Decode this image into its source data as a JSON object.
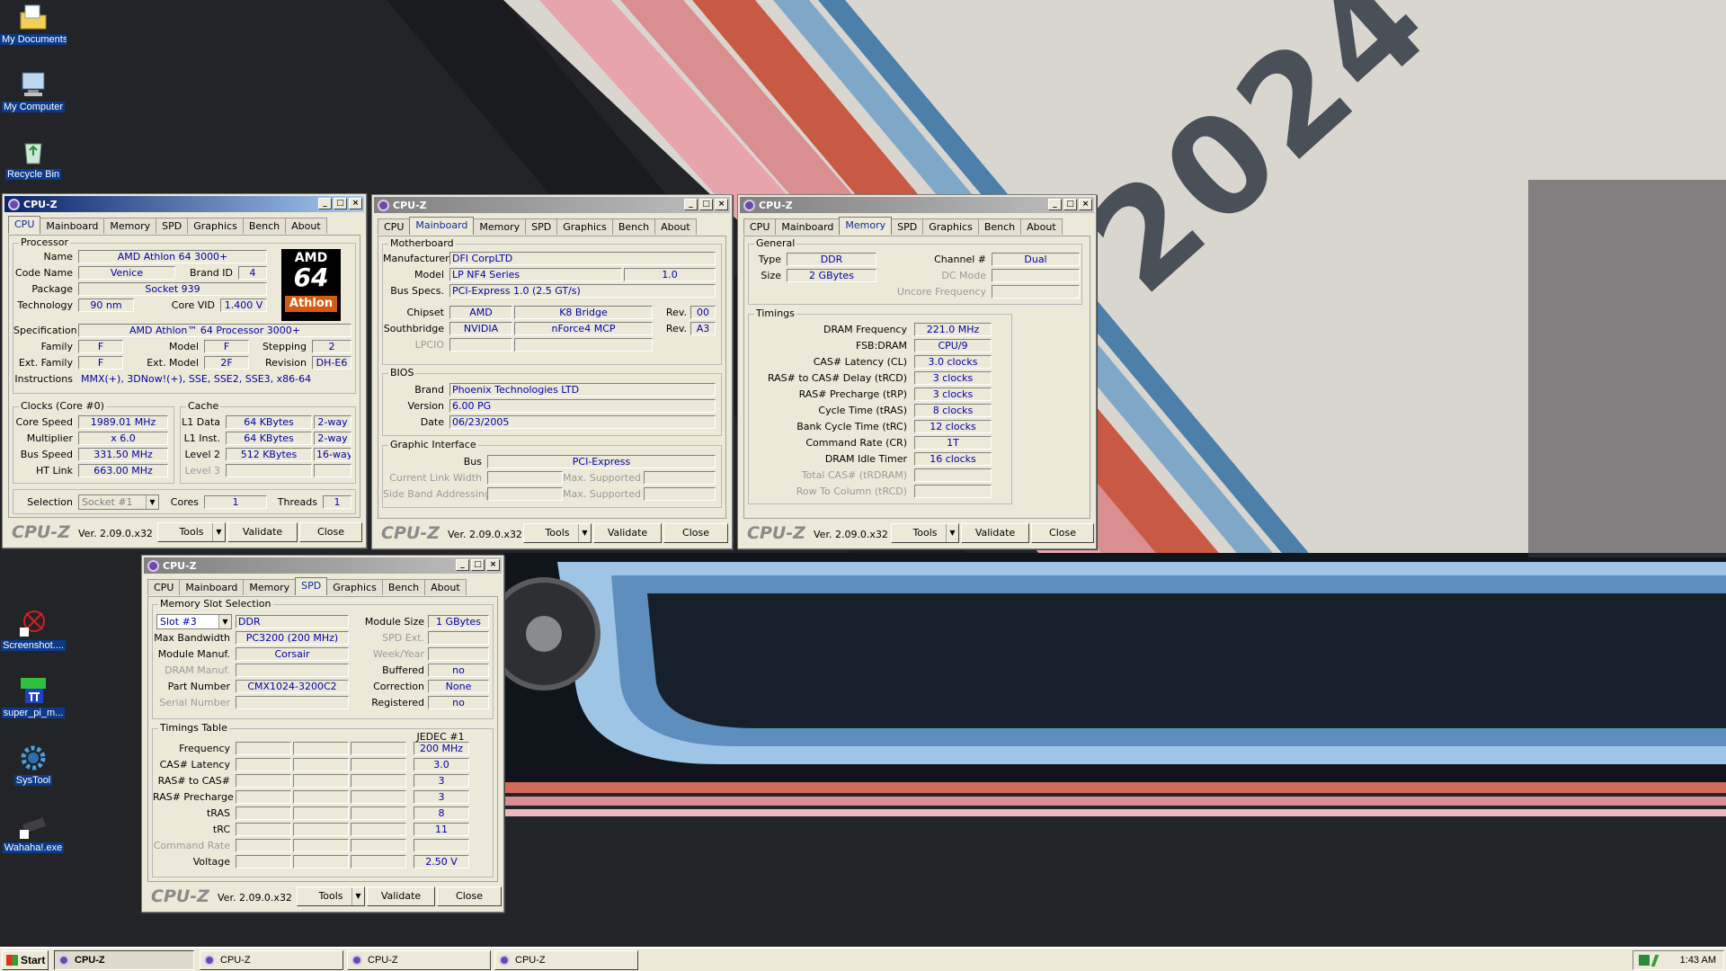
{
  "desktop": {
    "icons": [
      {
        "label": "My Documents",
        "icon": "folder-documents-icon"
      },
      {
        "label": "My Computer",
        "icon": "computer-icon"
      },
      {
        "label": "Recycle Bin",
        "icon": "recycle-bin-icon"
      },
      {
        "label": "Screenshot....",
        "icon": "screenshot-tool-icon"
      },
      {
        "label": "super_pi_m...",
        "icon": "super-pi-icon"
      },
      {
        "label": "SysTool",
        "icon": "systool-gear-icon"
      },
      {
        "label": "Wahaha!.exe",
        "icon": "wahaha-exe-icon"
      }
    ],
    "wallpaper_text": "2024"
  },
  "common": {
    "title": "CPU-Z",
    "brand": "CPU-Z",
    "version": "Ver. 2.09.0.x32",
    "tools": "Tools",
    "validate": "Validate",
    "close": "Close",
    "tabs": [
      "CPU",
      "Mainboard",
      "Memory",
      "SPD",
      "Graphics",
      "Bench",
      "About"
    ]
  },
  "cpu": {
    "processor": "Processor",
    "name_lbl": "Name",
    "name": "AMD Athlon 64 3000+",
    "codename_lbl": "Code Name",
    "codename": "Venice",
    "brandid_lbl": "Brand ID",
    "brandid": "4",
    "package_lbl": "Package",
    "package": "Socket 939",
    "tech_lbl": "Technology",
    "tech": "90 nm",
    "vid_lbl": "Core VID",
    "vid": "1.400 V",
    "spec_lbl": "Specification",
    "spec": "AMD Athlon™ 64 Processor 3000+",
    "family_lbl": "Family",
    "family": "F",
    "model_lbl": "Model",
    "model": "F",
    "stepping_lbl": "Stepping",
    "stepping": "2",
    "extfam_lbl": "Ext. Family",
    "extfam": "F",
    "extmodel_lbl": "Ext. Model",
    "extmodel": "2F",
    "revision_lbl": "Revision",
    "revision": "DH-E6",
    "instr_lbl": "Instructions",
    "instr": "MMX(+), 3DNow!(+), SSE, SSE2, SSE3, x86-64",
    "logo_brand": "AMD",
    "logo_num": "64",
    "logo_name": "Athlon",
    "clocks": "Clocks (Core #0)",
    "corespeed_lbl": "Core Speed",
    "corespeed": "1989.01 MHz",
    "mult_lbl": "Multiplier",
    "mult": "x 6.0",
    "bus_lbl": "Bus Speed",
    "bus": "331.50 MHz",
    "ht_lbl": "HT Link",
    "ht": "663.00 MHz",
    "cache": "Cache",
    "l1d_lbl": "L1 Data",
    "l1d": "64 KBytes",
    "l1d_w": "2-way",
    "l1i_lbl": "L1 Inst.",
    "l1i": "64 KBytes",
    "l1i_w": "2-way",
    "l2_lbl": "Level 2",
    "l2": "512 KBytes",
    "l2_w": "16-way",
    "l3_lbl": "Level 3",
    "sel_lbl": "Selection",
    "sel": "Socket #1",
    "cores_lbl": "Cores",
    "cores": "1",
    "threads_lbl": "Threads",
    "threads": "1"
  },
  "mb": {
    "motherboard": "Motherboard",
    "manuf_lbl": "Manufacturer",
    "manuf": "DFI CorpLTD",
    "model_lbl": "Model",
    "model": "LP NF4 Series",
    "model_rev": "1.0",
    "busspecs_lbl": "Bus Specs.",
    "busspecs": "PCI-Express 1.0 (2.5 GT/s)",
    "chipset_lbl": "Chipset",
    "chipset": "AMD",
    "chipset2": "K8 Bridge",
    "rev_lbl": "Rev.",
    "chipset_rev": "00",
    "south_lbl": "Southbridge",
    "south": "NVIDIA",
    "south2": "nForce4 MCP",
    "south_rev": "A3",
    "lpcio_lbl": "LPCIO",
    "bios": "BIOS",
    "brand_lbl": "Brand",
    "brand": "Phoenix Technologies LTD",
    "version_lbl": "Version",
    "version": "6.00 PG",
    "date_lbl": "Date",
    "date": "06/23/2005",
    "gi": "Graphic Interface",
    "gi_bus_lbl": "Bus",
    "gi_bus": "PCI-Express",
    "cur_lbl": "Current Link Width",
    "max_lbl": "Max. Supported",
    "side_lbl": "Side Band Addressing",
    "max2_lbl": "Max. Supported"
  },
  "mem": {
    "general": "General",
    "type_lbl": "Type",
    "type": "DDR",
    "size_lbl": "Size",
    "size": "2 GBytes",
    "channel_lbl": "Channel #",
    "channel": "Dual",
    "dcmode_lbl": "DC Mode",
    "uncore_lbl": "Uncore Frequency",
    "timings": "Timings",
    "rows": [
      {
        "label": "DRAM Frequency",
        "value": "221.0 MHz"
      },
      {
        "label": "FSB:DRAM",
        "value": "CPU/9"
      },
      {
        "label": "CAS# Latency (CL)",
        "value": "3.0 clocks"
      },
      {
        "label": "RAS# to CAS# Delay (tRCD)",
        "value": "3 clocks"
      },
      {
        "label": "RAS# Precharge (tRP)",
        "value": "3 clocks"
      },
      {
        "label": "Cycle Time (tRAS)",
        "value": "8 clocks"
      },
      {
        "label": "Bank Cycle Time (tRC)",
        "value": "12 clocks"
      },
      {
        "label": "Command Rate (CR)",
        "value": "1T"
      },
      {
        "label": "DRAM Idle Timer",
        "value": "16 clocks"
      }
    ],
    "total_cas_lbl": "Total CAS# (tRDRAM)",
    "row_to_col_lbl": "Row To Column (tRCD)"
  },
  "spd": {
    "slotsel": "Memory Slot Selection",
    "slot": "Slot #3",
    "type": "DDR",
    "modsize_lbl": "Module Size",
    "modsize": "1 GBytes",
    "maxbw_lbl": "Max Bandwidth",
    "maxbw": "PC3200 (200 MHz)",
    "spdext_lbl": "SPD Ext.",
    "modmanuf_lbl": "Module Manuf.",
    "modmanuf": "Corsair",
    "weekyear_lbl": "Week/Year",
    "drammanuf_lbl": "DRAM Manuf.",
    "buffered_lbl": "Buffered",
    "buffered": "no",
    "part_lbl": "Part Number",
    "part": "CMX1024-3200C2",
    "correction_lbl": "Correction",
    "correction": "None",
    "serial_lbl": "Serial Number",
    "registered_lbl": "Registered",
    "registered": "no",
    "tt": "Timings Table",
    "jedec": "JEDEC #1",
    "rows": [
      {
        "label": "Frequency",
        "value": "200 MHz",
        "dis": false
      },
      {
        "label": "CAS# Latency",
        "value": "3.0",
        "dis": false
      },
      {
        "label": "RAS# to CAS#",
        "value": "3",
        "dis": false
      },
      {
        "label": "RAS# Precharge",
        "value": "3",
        "dis": false
      },
      {
        "label": "tRAS",
        "value": "8",
        "dis": false
      },
      {
        "label": "tRC",
        "value": "11",
        "dis": false
      },
      {
        "label": "Command Rate",
        "value": "",
        "dis": true
      },
      {
        "label": "Voltage",
        "value": "2.50 V",
        "dis": false
      }
    ]
  },
  "taskbar": {
    "start": "Start",
    "buttons": [
      "CPU-Z",
      "CPU-Z",
      "CPU-Z",
      "CPU-Z"
    ],
    "clock": "1:43 AM"
  }
}
